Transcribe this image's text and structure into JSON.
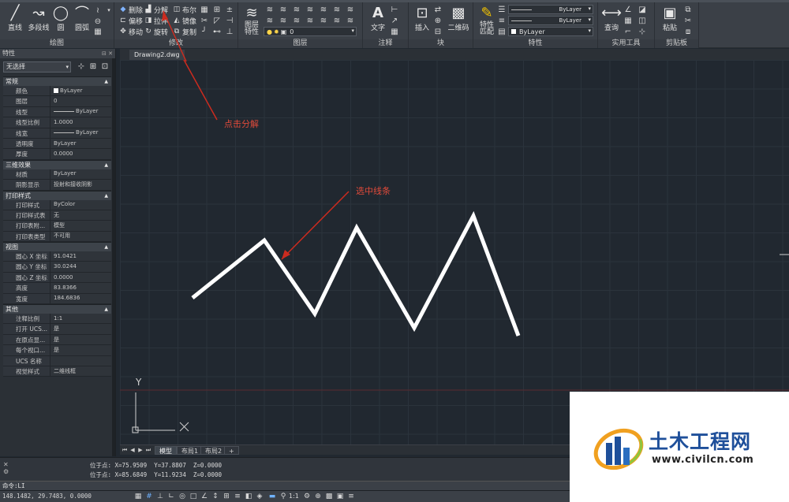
{
  "ribbon": {
    "draw": {
      "label": "绘图",
      "line": "直线",
      "polyline": "多段线",
      "circle": "圆",
      "arc": "圆弧"
    },
    "modify": {
      "label": "修改",
      "erase": "删除",
      "explode": "分解",
      "boolean": "布尔",
      "offset": "偏移",
      "stretch": "拉伸",
      "mirror": "镜像",
      "move": "移动",
      "rotate": "旋转",
      "copy": "复制"
    },
    "layers": {
      "label": "图层",
      "layer_props": "图层\n特性",
      "current_layer": "0"
    },
    "annotation": {
      "label": "注释",
      "text": "文字"
    },
    "block": {
      "label": "块",
      "insert": "插入",
      "qrcode": "二维码"
    },
    "properties": {
      "label": "特性",
      "match": "特性\n匹配",
      "color": "ByLayer",
      "linetype": "ByLayer",
      "lineweight": "ByLayer"
    },
    "utilities": {
      "label": "实用工具",
      "query": "查询"
    },
    "clipboard": {
      "label": "剪贴板",
      "paste": "粘贴"
    }
  },
  "properties_palette": {
    "title": "特性",
    "selection": "无选择",
    "categories": [
      {
        "name": "常规",
        "rows": [
          {
            "key": "颜色",
            "value": "ByLayer",
            "kind": "color"
          },
          {
            "key": "图层",
            "value": "0",
            "kind": "text"
          },
          {
            "key": "线型",
            "value": "ByLayer",
            "kind": "line"
          },
          {
            "key": "线型比例",
            "value": "1.0000",
            "kind": "text"
          },
          {
            "key": "线宽",
            "value": "ByLayer",
            "kind": "line"
          },
          {
            "key": "透明度",
            "value": "ByLayer",
            "kind": "text"
          },
          {
            "key": "厚度",
            "value": "0.0000",
            "kind": "text"
          }
        ]
      },
      {
        "name": "三维效果",
        "rows": [
          {
            "key": "材质",
            "value": "ByLayer",
            "kind": "text"
          },
          {
            "key": "阴影显示",
            "value": "投射和接收阴影",
            "kind": "text"
          }
        ]
      },
      {
        "name": "打印样式",
        "rows": [
          {
            "key": "打印样式",
            "value": "ByColor",
            "kind": "text"
          },
          {
            "key": "打印样式表",
            "value": "无",
            "kind": "text"
          },
          {
            "key": "打印表附...",
            "value": "模型",
            "kind": "text"
          },
          {
            "key": "打印表类型",
            "value": "不可用",
            "kind": "text"
          }
        ]
      },
      {
        "name": "视图",
        "rows": [
          {
            "key": "圆心 X 坐标",
            "value": "91.0421",
            "kind": "text"
          },
          {
            "key": "圆心 Y 坐标",
            "value": "30.0244",
            "kind": "text"
          },
          {
            "key": "圆心 Z 坐标",
            "value": "0.0000",
            "kind": "text"
          },
          {
            "key": "高度",
            "value": "83.8366",
            "kind": "text"
          },
          {
            "key": "宽度",
            "value": "184.6836",
            "kind": "text"
          }
        ]
      },
      {
        "name": "其他",
        "rows": [
          {
            "key": "注释比例",
            "value": "1:1",
            "kind": "text"
          },
          {
            "key": "打开 UCS...",
            "value": "是",
            "kind": "text"
          },
          {
            "key": "在原点显...",
            "value": "是",
            "kind": "text"
          },
          {
            "key": "每个视口...",
            "value": "是",
            "kind": "text"
          },
          {
            "key": "UCS 名称",
            "value": "",
            "kind": "text"
          },
          {
            "key": "视觉样式",
            "value": "二维线框",
            "kind": "text"
          }
        ]
      }
    ]
  },
  "document": {
    "tab": "Drawing2.dwg",
    "ucs_y": "Y",
    "annotations": {
      "explode_hint": "点击分解",
      "select_hint": "选中线条"
    }
  },
  "layout_tabs": [
    "模型",
    "布局1",
    "布局2",
    "+"
  ],
  "command": {
    "history": [
      "位于点: X=75.9509  Y=37.8807  Z=0.0000",
      "位于点: X=85.6849  Y=11.9234  Z=0.0000"
    ],
    "prompt": "命令:LI"
  },
  "status": {
    "coords": "148.1482, 29.7483, 0.0000",
    "scale": "1:1"
  },
  "watermark": {
    "title": "土木工程网",
    "url": "www.civilcn.com"
  },
  "colors": {
    "canvas_bg": "#212830",
    "annotation_red": "#e04a3a",
    "brand_blue": "#1e4f9a"
  }
}
